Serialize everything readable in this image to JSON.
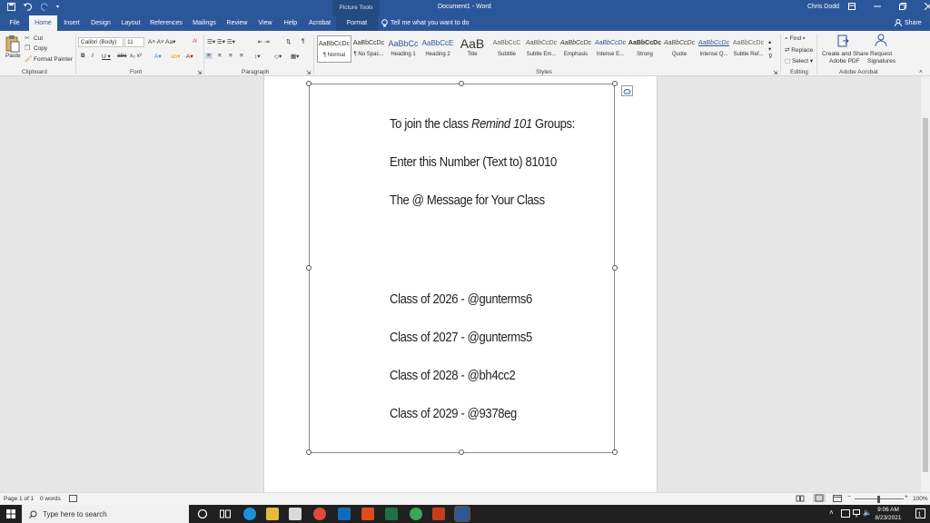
{
  "titlebar": {
    "document_title": "Document1 - Word",
    "picture_tools": "Picture Tools",
    "user": "Chris Dodd"
  },
  "tabs": [
    "File",
    "Home",
    "Insert",
    "Design",
    "Layout",
    "References",
    "Mailings",
    "Review",
    "View",
    "Help",
    "Acrobat",
    "Format"
  ],
  "tell_me": "Tell me what you want to do",
  "share": "Share",
  "clipboard": {
    "paste": "Paste",
    "cut": "Cut",
    "copy": "Copy",
    "format_painter": "Format Painter",
    "label": "Clipboard"
  },
  "font": {
    "name": "Calibri (Body)",
    "size": "11",
    "label": "Font"
  },
  "paragraph": {
    "label": "Paragraph"
  },
  "styles": {
    "label": "Styles",
    "items": [
      {
        "sample": "AaBbCcDc",
        "name": "¶ Normal"
      },
      {
        "sample": "AaBbCcDc",
        "name": "¶ No Spac..."
      },
      {
        "sample": "AaBbCc",
        "name": "Heading 1"
      },
      {
        "sample": "AaBbCcE",
        "name": "Heading 2"
      },
      {
        "sample": "AaB",
        "name": "Title"
      },
      {
        "sample": "AaBbCcC",
        "name": "Subtitle"
      },
      {
        "sample": "AaBbCcDc",
        "name": "Subtle Em..."
      },
      {
        "sample": "AaBbCcDc",
        "name": "Emphasis"
      },
      {
        "sample": "AaBbCcDc",
        "name": "Intense E..."
      },
      {
        "sample": "AaBbCcDc",
        "name": "Strong"
      },
      {
        "sample": "AaBbCcDc",
        "name": "Quote"
      },
      {
        "sample": "AaBbCcDc",
        "name": "Intense Q..."
      },
      {
        "sample": "AaBbCcDc",
        "name": "Subtle Ref..."
      }
    ]
  },
  "editing": {
    "find": "Find",
    "replace": "Replace",
    "select": "Select",
    "label": "Editing"
  },
  "acrobat": {
    "create_share": "Create and Share",
    "adobe_pdf": "Adobe PDF",
    "request": "Request",
    "signatures": "Signatures",
    "label": "Adobe Acrobat"
  },
  "document": {
    "line1_pre": "To join the class ",
    "line1_em": "Remind 101",
    "line1_post": " Groups:",
    "line2": "Enter this Number (Text to) 81010",
    "line3": "The @ Message for Your Class",
    "classes": [
      "Class of 2026 - @gunterms6",
      "Class of 2027 - @gunterms5",
      "Class of 2028 - @bh4cc2",
      "Class of 2029 - @9378eg"
    ]
  },
  "status": {
    "page": "Page 1 of 1",
    "words": "0 words",
    "zoom": "100%"
  },
  "taskbar": {
    "search": "Type here to search",
    "time": "9:06 AM",
    "date": "8/23/2021"
  },
  "colors": {
    "word_blue": "#2b579a",
    "format_tab": "#234a83"
  }
}
